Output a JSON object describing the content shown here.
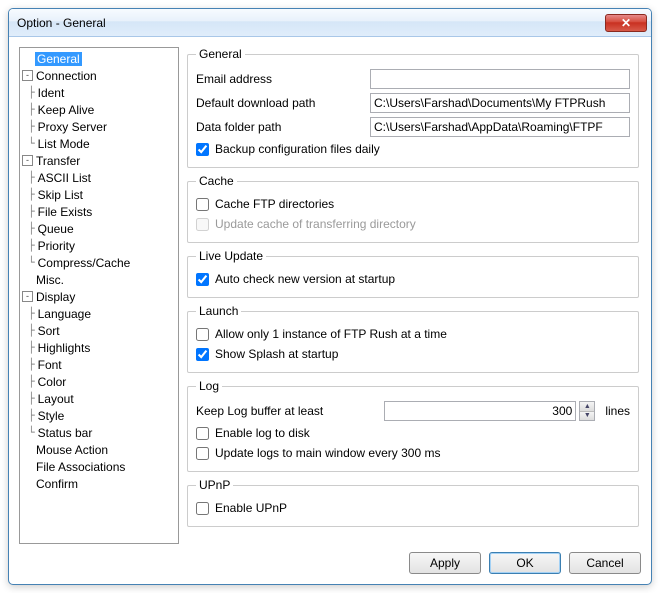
{
  "window": {
    "title": "Option - General"
  },
  "tree": [
    {
      "label": "General",
      "level": 0,
      "exp": null,
      "selected": true
    },
    {
      "label": "Connection",
      "level": 0,
      "exp": "-"
    },
    {
      "label": "Ident",
      "level": 1
    },
    {
      "label": "Keep Alive",
      "level": 1
    },
    {
      "label": "Proxy Server",
      "level": 1
    },
    {
      "label": "List Mode",
      "level": 1,
      "last": true
    },
    {
      "label": "Transfer",
      "level": 0,
      "exp": "-"
    },
    {
      "label": "ASCII List",
      "level": 1
    },
    {
      "label": "Skip List",
      "level": 1
    },
    {
      "label": "File Exists",
      "level": 1
    },
    {
      "label": "Queue",
      "level": 1
    },
    {
      "label": "Priority",
      "level": 1
    },
    {
      "label": "Compress/Cache",
      "level": 1,
      "last": true
    },
    {
      "label": "Misc.",
      "level": 0,
      "exp": null
    },
    {
      "label": "Display",
      "level": 0,
      "exp": "-"
    },
    {
      "label": "Language",
      "level": 1
    },
    {
      "label": "Sort",
      "level": 1
    },
    {
      "label": "Highlights",
      "level": 1
    },
    {
      "label": "Font",
      "level": 1
    },
    {
      "label": "Color",
      "level": 1
    },
    {
      "label": "Layout",
      "level": 1
    },
    {
      "label": "Style",
      "level": 1
    },
    {
      "label": "Status bar",
      "level": 1,
      "last": true
    },
    {
      "label": "Mouse Action",
      "level": 0,
      "exp": null
    },
    {
      "label": "File Associations",
      "level": 0,
      "exp": null
    },
    {
      "label": "Confirm",
      "level": 0,
      "exp": null
    }
  ],
  "general": {
    "legend": "General",
    "email_label": "Email address",
    "email_value": "",
    "path_label": "Default download path",
    "path_value": "C:\\Users\\Farshad\\Documents\\My FTPRush",
    "data_label": "Data folder path",
    "data_value": "C:\\Users\\Farshad\\AppData\\Roaming\\FTPF",
    "backup_label": "Backup configuration files daily"
  },
  "cache": {
    "legend": "Cache",
    "cache_ftp": "Cache FTP directories",
    "update_cache": "Update cache of transferring directory"
  },
  "live": {
    "legend": "Live Update",
    "auto_check": "Auto check new version at startup"
  },
  "launch": {
    "legend": "Launch",
    "single_instance": "Allow only 1 instance of FTP Rush at a time",
    "show_splash": "Show Splash at startup"
  },
  "log": {
    "legend": "Log",
    "keep_label": "Keep Log buffer at least",
    "keep_value": "300",
    "keep_suffix": "lines",
    "enable_disk": "Enable log to disk",
    "update_main": "Update logs to main window every 300 ms"
  },
  "upnp": {
    "legend": "UPnP",
    "enable": "Enable UPnP"
  },
  "buttons": {
    "apply": "Apply",
    "ok": "OK",
    "cancel": "Cancel"
  }
}
